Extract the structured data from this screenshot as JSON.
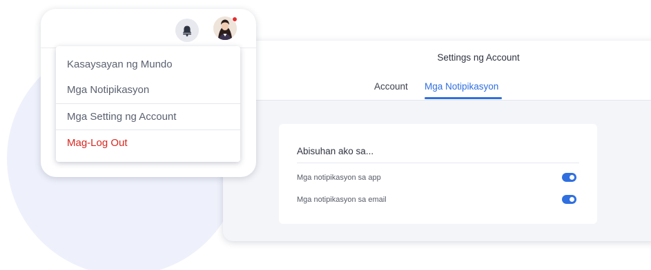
{
  "profile_menu": {
    "items": [
      {
        "label": "Kasaysayan ng Mundo"
      },
      {
        "label": "Mga Notipikasyon"
      },
      {
        "label": "Mga Setting ng Account"
      },
      {
        "label": "Mag-Log Out",
        "color": "#d8261f"
      }
    ],
    "icons": {
      "bell": "bell-icon",
      "avatar": "user-avatar",
      "badge": "notification-dot"
    }
  },
  "settings": {
    "title": "Settings ng Account",
    "tabs": [
      {
        "label": "Account",
        "active": false
      },
      {
        "label": "Mga Notipikasyon",
        "active": true
      }
    ],
    "notifications": {
      "heading": "Abisuhan ako sa...",
      "options": [
        {
          "label": "Mga notipikasyon sa app",
          "enabled": true
        },
        {
          "label": "Mga notipikasyon sa email",
          "enabled": true
        }
      ]
    }
  },
  "colors": {
    "accent": "#2f6fe0",
    "logout": "#d8261f",
    "badge": "#e52e2e",
    "background_circle": "#eef1fb"
  }
}
